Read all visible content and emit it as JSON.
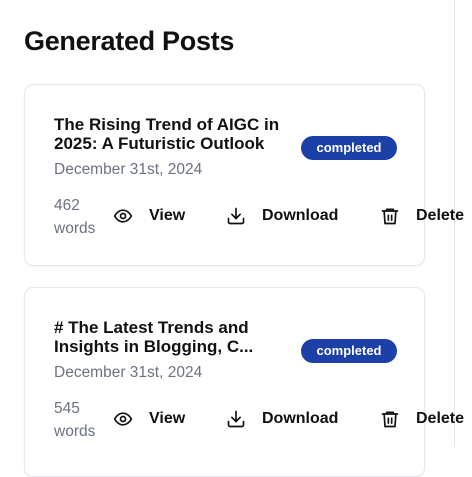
{
  "page": {
    "title": "Generated Posts"
  },
  "posts": [
    {
      "title": "The Rising Trend of AIGC in 2025: A Futuristic Outlook",
      "status": "completed",
      "date": "December 31st, 2024",
      "word_count": "462",
      "word_unit": "words",
      "actions": {
        "view": "View",
        "download": "Download",
        "delete": "Delete"
      }
    },
    {
      "title": "# The Latest Trends and Insights in Blogging, C...",
      "status": "completed",
      "date": "December 31st, 2024",
      "word_count": "545",
      "word_unit": "words",
      "actions": {
        "view": "View",
        "download": "Download",
        "delete": "Delete"
      }
    }
  ],
  "colors": {
    "badge_bg": "#1d40a8",
    "muted_text": "#6b7280",
    "border": "#e5e7eb"
  },
  "icons": {
    "view": "eye-icon",
    "download": "download-icon",
    "delete": "trash-icon"
  }
}
